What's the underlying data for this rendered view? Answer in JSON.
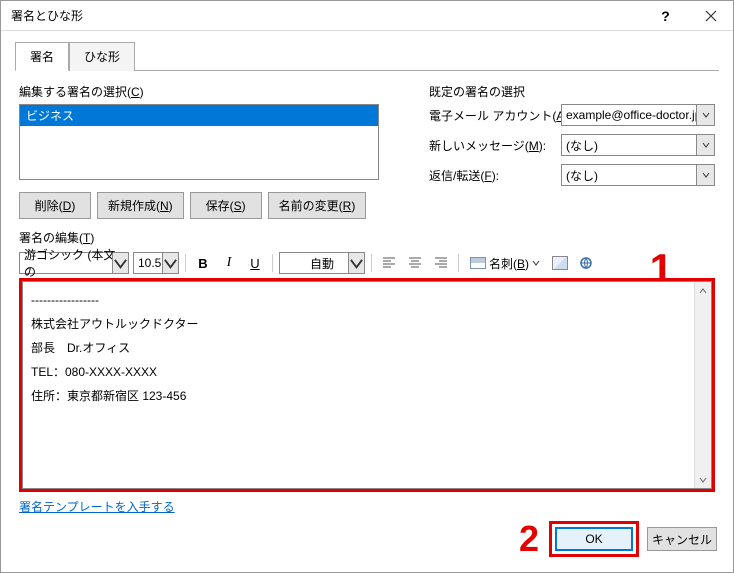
{
  "title": "署名とひな形",
  "tabs": {
    "signature": "署名",
    "stationery": "ひな形"
  },
  "left": {
    "label": "編集する署名の選択(C)",
    "items": [
      "ビジネス"
    ],
    "buttons": {
      "delete": "削除(D)",
      "new": "新規作成(N)",
      "save": "保存(S)",
      "rename": "名前の変更(R)"
    }
  },
  "right": {
    "label": "既定の署名の選択",
    "account_label": "電子メール アカウント(A):",
    "account_value": "example@office-doctor.jp",
    "newmsg_label": "新しいメッセージ(M):",
    "newmsg_value": "(なし)",
    "reply_label": "返信/転送(F):",
    "reply_value": "(なし)"
  },
  "editor": {
    "label": "署名の編集(T)",
    "font": "游ゴシック (本文の",
    "size": "10.5",
    "color": "自動",
    "meishi": "名刺(B)",
    "lines": [
      "-----------------",
      "株式会社アウトルックドクター",
      "部長　Dr.オフィス",
      "TEL：080-XXXX-XXXX",
      "住所：東京都新宿区 123-456"
    ]
  },
  "template_link": "署名テンプレートを入手する",
  "annotations": {
    "a1": "1",
    "a2": "2"
  },
  "dlg": {
    "ok": "OK",
    "cancel": "キャンセル"
  }
}
